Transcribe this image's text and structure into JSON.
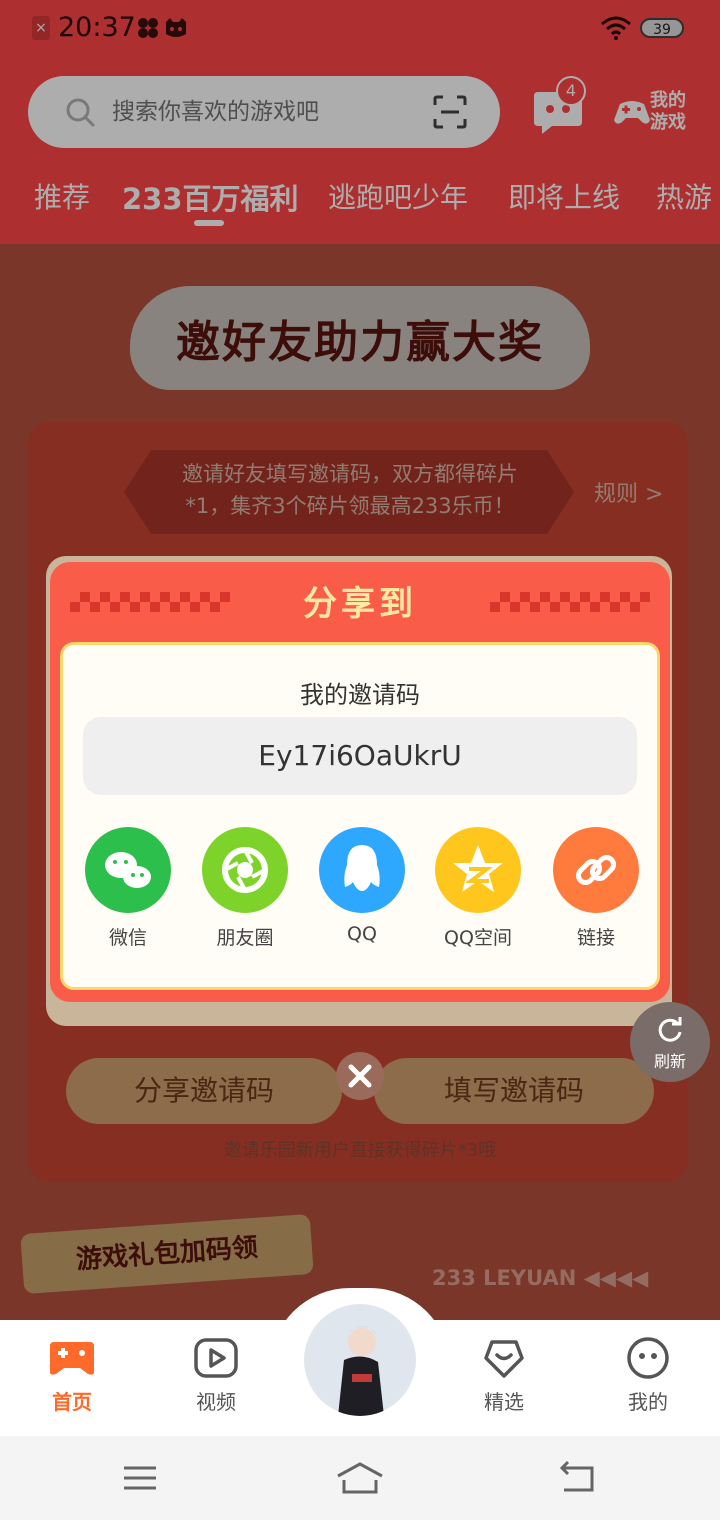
{
  "status_bar": {
    "time": "20:37",
    "battery": "39"
  },
  "header": {
    "search_placeholder": "搜索你喜欢的游戏吧",
    "message_badge": "4",
    "my_games_label_1": "我的",
    "my_games_label_2": "游戏",
    "tabs": [
      "推荐",
      "233百万福利",
      "逃跑吧少年",
      "即将上线",
      "热游"
    ],
    "active_tab": 1
  },
  "background": {
    "banner_title": "邀好友助力赢大奖",
    "note_line1": "邀请好友填写邀请码，双方都得碎片",
    "note_line2": "*1，集齐3个碎片领最高233乐币！",
    "rules": "规则 >",
    "share_code_button": "分享邀请码",
    "fill_code_button": "填写邀请码",
    "hint": "邀请乐园新用户直接获得碎片*3哦",
    "gift_tag": "游戏礼包加码领",
    "leyuan": "233 LEYUAN",
    "refresh": "刷新"
  },
  "modal": {
    "title": "分享到",
    "invite_label": "我的邀请码",
    "invite_code": "Ey17i6OaUkrU",
    "share_targets": [
      {
        "label": "微信",
        "color": "#2dbf4b",
        "icon": "wechat-icon"
      },
      {
        "label": "朋友圈",
        "color": "#7ed32a",
        "icon": "moments-icon"
      },
      {
        "label": "QQ",
        "color": "#2ea8ff",
        "icon": "qq-icon"
      },
      {
        "label": "QQ空间",
        "color": "#ffc71e",
        "icon": "qzone-icon"
      },
      {
        "label": "链接",
        "color": "#ff7a3d",
        "icon": "link-icon"
      }
    ]
  },
  "bottom_nav": {
    "items": [
      {
        "label": "首页",
        "icon": "gamepad-icon",
        "active": true
      },
      {
        "label": "视频",
        "icon": "video-icon",
        "active": false
      },
      {
        "label": "精选",
        "icon": "heart-chat-icon",
        "active": false
      },
      {
        "label": "我的",
        "icon": "profile-face-icon",
        "active": false
      }
    ]
  },
  "colors": {
    "brand_red": "#ff4646",
    "active_orange": "#ff6a2a"
  }
}
